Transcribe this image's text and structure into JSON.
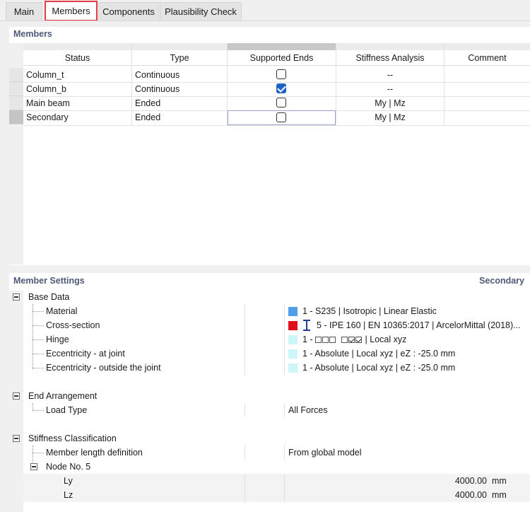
{
  "tabs": [
    "Main",
    "Members",
    "Components",
    "Plausibility Check"
  ],
  "members_panel": {
    "title": "Members",
    "columns": [
      "Status",
      "Type",
      "Supported Ends",
      "Stiffness Analysis",
      "Comment"
    ],
    "rows": [
      {
        "status": "Column_t",
        "type": "Continuous",
        "supported": false,
        "stiffness": "--",
        "comment": ""
      },
      {
        "status": "Column_b",
        "type": "Continuous",
        "supported": true,
        "stiffness": "--",
        "comment": ""
      },
      {
        "status": "Main beam",
        "type": "Ended",
        "supported": false,
        "stiffness": "My | Mz",
        "comment": ""
      },
      {
        "status": "Secondary",
        "type": "Ended",
        "supported": false,
        "stiffness": "My | Mz",
        "comment": ""
      }
    ]
  },
  "settings_panel": {
    "title": "Member Settings",
    "selected": "Secondary",
    "base_data": {
      "label": "Base Data",
      "material_label": "Material",
      "material_value": "1 - S235 | Isotropic | Linear Elastic",
      "material_color": "#4f9ee8",
      "cross_section_label": "Cross-section",
      "cross_section_value": "5 - IPE 160 | EN 10365:2017 | ArcelorMittal (2018)...",
      "cross_section_color": "#e0101a",
      "hinge_label": "Hinge",
      "hinge_prefix": "1 -",
      "hinge_suffix": "| Local xyz",
      "hinge_color": "#ccf6f8",
      "ecc_joint_label": "Eccentricity - at joint",
      "ecc_joint_value": "1 - Absolute | Local xyz | eZ : -25.0 mm",
      "ecc_outside_label": "Eccentricity - outside the joint",
      "ecc_outside_value": "1 - Absolute | Local xyz | eZ : -25.0 mm"
    },
    "end_arrangement": {
      "label": "End Arrangement",
      "load_type_label": "Load Type",
      "load_type_value": "All Forces"
    },
    "stiffness": {
      "label": "Stiffness Classification",
      "length_def_label": "Member length definition",
      "length_def_value": "From global model",
      "node_label": "Node No. 5",
      "ly_label": "Ly",
      "ly_value": "4000.00",
      "lz_label": "Lz",
      "lz_value": "4000.00",
      "unit": "mm"
    }
  }
}
